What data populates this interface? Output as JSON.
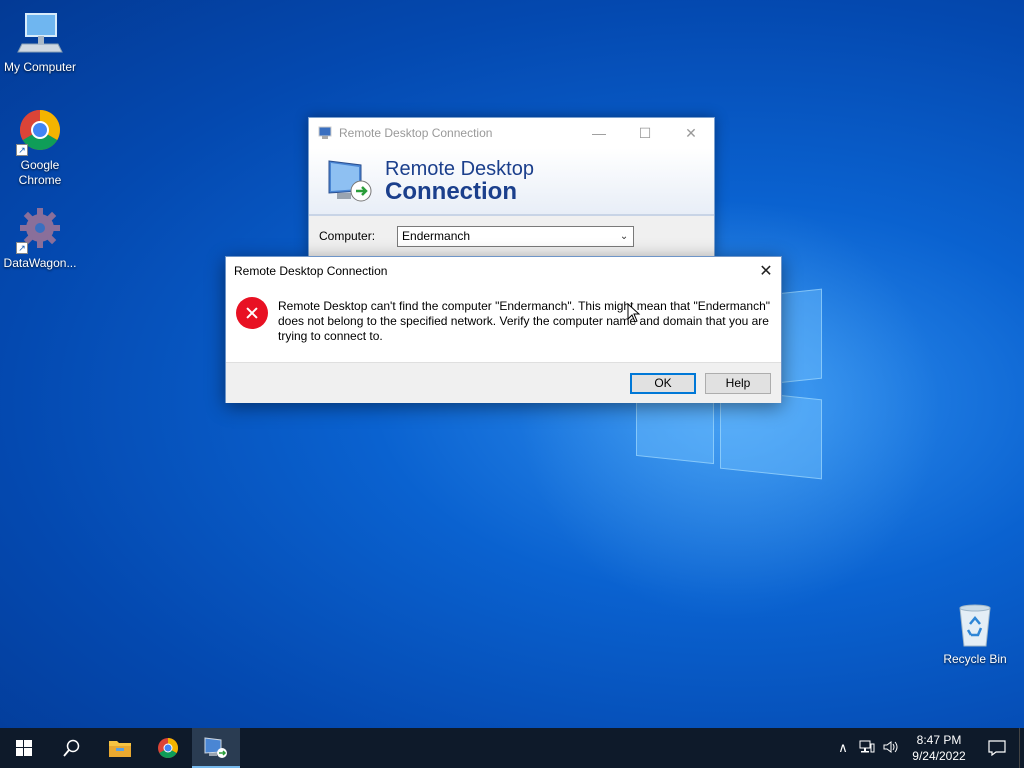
{
  "desktop": {
    "icons": [
      {
        "label": "My Computer"
      },
      {
        "label": "Google Chrome"
      },
      {
        "label": "DataWagon..."
      },
      {
        "label": "Recycle Bin"
      }
    ]
  },
  "rdp_window": {
    "title": "Remote Desktop Connection",
    "banner_line1": "Remote Desktop",
    "banner_line2": "Connection",
    "computer_label": "Computer:",
    "computer_value": "Endermanch",
    "controls": {
      "minimize": "—",
      "maximize": "☐",
      "close": "✕"
    }
  },
  "error_dialog": {
    "title": "Remote Desktop Connection",
    "close": "✕",
    "message": "Remote Desktop can't find the computer \"Endermanch\". This might mean that \"Endermanch\" does not belong to the specified network.  Verify the computer name and domain that you are trying to connect to.",
    "ok_label": "OK",
    "help_label": "Help"
  },
  "taskbar": {
    "clock_time": "8:47 PM",
    "clock_date": "9/24/2022",
    "tray_chevron": "∧",
    "tray_volume": "🔊"
  },
  "colors": {
    "accent": "#0078d7",
    "error_red": "#e81123",
    "taskbar": "#0e1a2a",
    "banner_text": "#1b3f8c"
  }
}
